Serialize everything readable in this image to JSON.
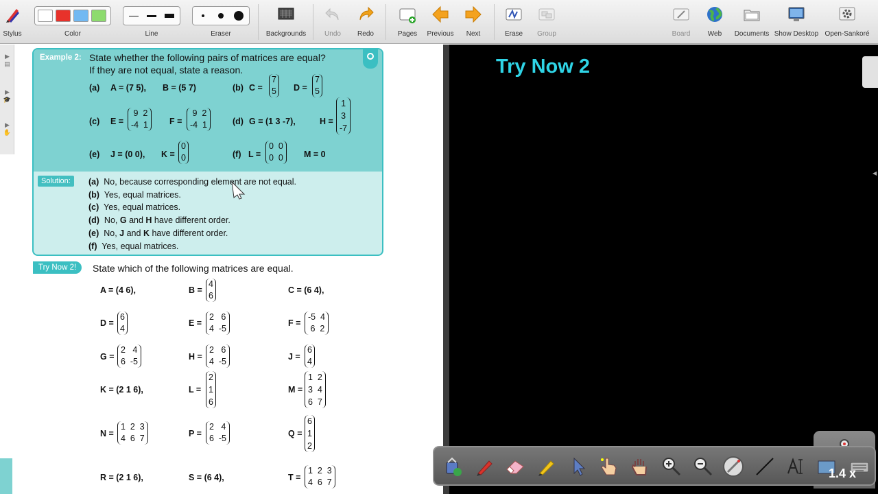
{
  "toolbar": {
    "stylus": "Stylus",
    "color": "Color",
    "line": "Line",
    "eraser": "Eraser",
    "backgrounds": "Backgrounds",
    "undo": "Undo",
    "redo": "Redo",
    "pages": "Pages",
    "previous": "Previous",
    "next": "Next",
    "erase": "Erase",
    "group": "Group",
    "board": "Board",
    "web": "Web",
    "documents": "Documents",
    "show_desktop": "Show Desktop",
    "open_sankore": "Open-Sankoré",
    "colors": [
      "#ffffff",
      "#e8322b",
      "#72b9f2",
      "#8ddb6e"
    ]
  },
  "example": {
    "tag": "Example 2:",
    "q1": "State whether the following pairs of matrices are equal?",
    "q2": "If they are not equal, state a reason.",
    "a": "(a)",
    "a1": "A = (7  5),",
    "a2": "B = (5  7)",
    "b": "(b)",
    "b1": "C =",
    "b2": "D =",
    "c": "(c)",
    "c1": "E =",
    "c2": "F =",
    "d": "(d)",
    "d1": "G = (1  3  -7),",
    "d2": "H =",
    "e": "(e)",
    "e1": "J = (0  0),",
    "e2": "K =",
    "f": "(f)",
    "f1": "L =",
    "f2": "M = 0",
    "solution_tag": "Solution:",
    "solutions": [
      {
        "k": "(a)",
        "t": "No, because corresponding element are not equal."
      },
      {
        "k": "(b)",
        "t": "Yes, equal matrices."
      },
      {
        "k": "(c)",
        "t": "Yes, equal matrices."
      },
      {
        "k": "(d)",
        "t": "No, G and H have different order."
      },
      {
        "k": "(e)",
        "t": "No, J and K have different order."
      },
      {
        "k": "(f)",
        "t": "Yes, equal matrices."
      }
    ]
  },
  "trynow": {
    "tag": "Try Now 2!",
    "question": "State which of the following matrices are equal.",
    "A": "A = (4  6),",
    "B": "B =",
    "C": "C = (6  4),",
    "D": "D =",
    "E": "E =",
    "F": "F =",
    "G": "G =",
    "H": "H =",
    "J": "J =",
    "K": "K = (2  1  6),",
    "L": "L =",
    "M": "M =",
    "N": "N =",
    "P": "P =",
    "Q": "Q =",
    "R": "R = (2  1  6),",
    "S": "S = (6  4),",
    "T": "T ="
  },
  "board": {
    "title": "Try Now 2",
    "zoom": "1.4 x"
  }
}
